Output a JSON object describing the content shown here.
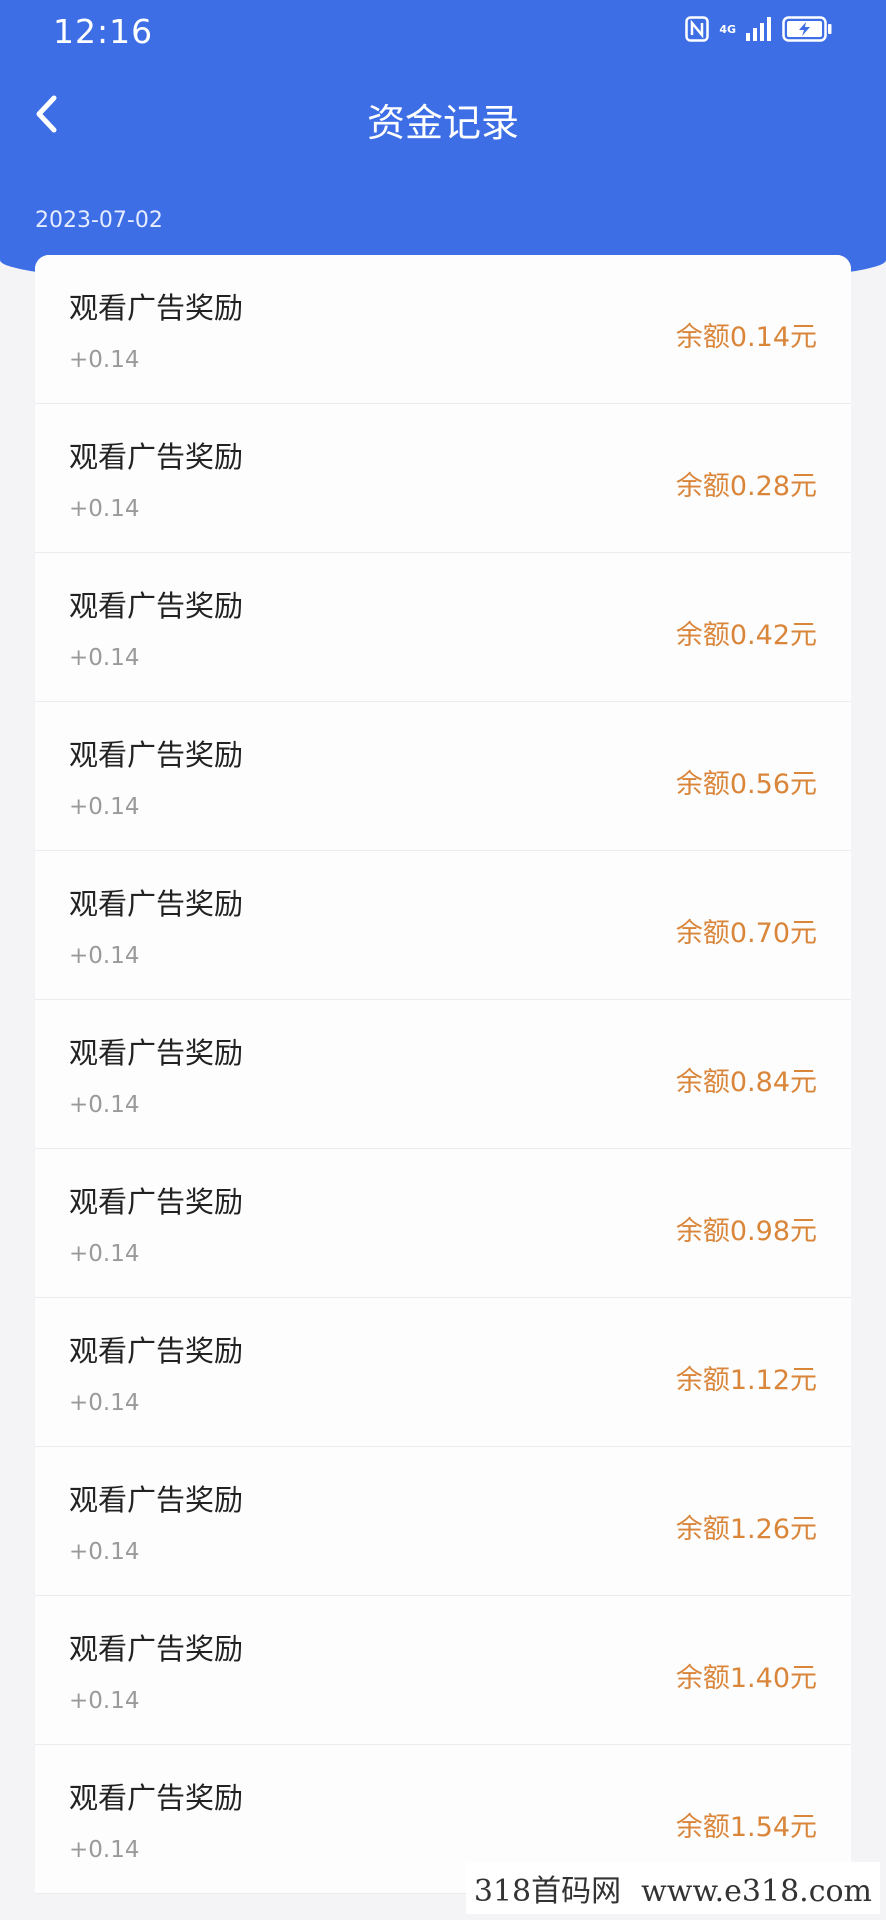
{
  "status_bar": {
    "time": "12:16",
    "icons": [
      "nfc-icon",
      "network-4g-icon",
      "signal-icon",
      "battery-charging-icon"
    ],
    "network_label": "4G"
  },
  "nav": {
    "back_icon": "chevron-left-icon",
    "title": "资金记录"
  },
  "colors": {
    "header": "#3d6ee6",
    "balance": "#d9853a",
    "background": "#f4f4f6"
  },
  "date": "2023-07-02",
  "records": [
    {
      "title": "观看广告奖励",
      "amount": "+0.14",
      "balance": "余额0.14元"
    },
    {
      "title": "观看广告奖励",
      "amount": "+0.14",
      "balance": "余额0.28元"
    },
    {
      "title": "观看广告奖励",
      "amount": "+0.14",
      "balance": "余额0.42元"
    },
    {
      "title": "观看广告奖励",
      "amount": "+0.14",
      "balance": "余额0.56元"
    },
    {
      "title": "观看广告奖励",
      "amount": "+0.14",
      "balance": "余额0.70元"
    },
    {
      "title": "观看广告奖励",
      "amount": "+0.14",
      "balance": "余额0.84元"
    },
    {
      "title": "观看广告奖励",
      "amount": "+0.14",
      "balance": "余额0.98元"
    },
    {
      "title": "观看广告奖励",
      "amount": "+0.14",
      "balance": "余额1.12元"
    },
    {
      "title": "观看广告奖励",
      "amount": "+0.14",
      "balance": "余额1.26元"
    },
    {
      "title": "观看广告奖励",
      "amount": "+0.14",
      "balance": "余额1.40元"
    },
    {
      "title": "观看广告奖励",
      "amount": "+0.14",
      "balance": "余额1.54元"
    }
  ],
  "watermark": {
    "brand": "318首码网",
    "url": "www.e318.com"
  }
}
